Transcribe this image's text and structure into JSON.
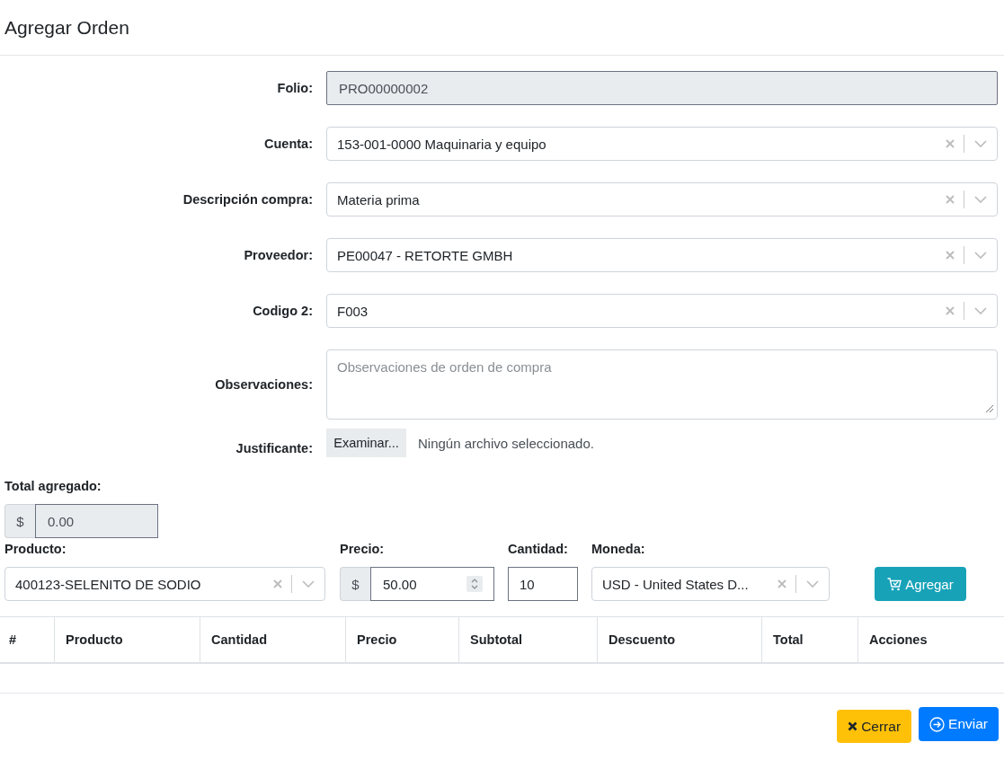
{
  "title": "Agregar Orden",
  "fields": [
    {
      "kind": "readonly",
      "label": "Folio:",
      "value": "PRO00000002"
    },
    {
      "kind": "select",
      "label": "Cuenta:",
      "value": "153-001-0000 Maquinaria y equipo"
    },
    {
      "kind": "select",
      "label": "Descripción compra:",
      "value": "Materia prima"
    },
    {
      "kind": "select",
      "label": "Proveedor:",
      "value": "PE00047 - RETORTE GMBH"
    },
    {
      "kind": "select",
      "label": "Codigo 2:",
      "value": "F003"
    },
    {
      "kind": "textarea",
      "label": "Observaciones:",
      "placeholder": "Observaciones de orden de compra"
    },
    {
      "kind": "file",
      "label": "Justificante:",
      "button": "Examinar...",
      "status": "Ningún archivo seleccionado."
    }
  ],
  "total": {
    "label": "Total agregado:",
    "prefix": "$",
    "value": "0.00"
  },
  "line": {
    "product": {
      "label": "Producto:",
      "value": "400123-SELENITO DE SODIO"
    },
    "price": {
      "label": "Precio:",
      "prefix": "$",
      "value": "50.00"
    },
    "quantity": {
      "label": "Cantidad:",
      "value": "10"
    },
    "currency": {
      "label": "Moneda:",
      "value": "USD - United States D..."
    },
    "add_button": "Agregar"
  },
  "table": {
    "columns": [
      "#",
      "Producto",
      "Cantidad",
      "Precio",
      "Subtotal",
      "Descuento",
      "Total",
      "Acciones"
    ]
  },
  "footer": {
    "buttons": [
      {
        "kind": "close",
        "label": "Cerrar"
      },
      {
        "kind": "send",
        "label": "Enviar"
      }
    ]
  }
}
